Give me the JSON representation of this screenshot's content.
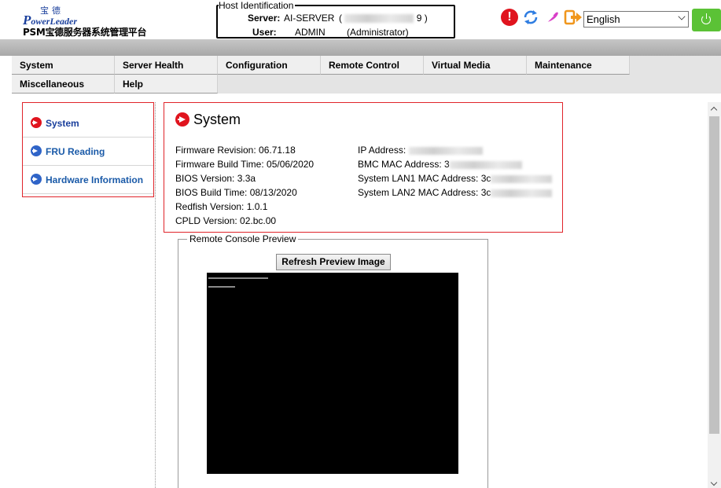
{
  "brand": {
    "logo_cn": "宝德",
    "logo_en_prefix": "P",
    "logo_en_rest": "owerLeader",
    "subtitle": "PSM宝德服务器系统管理平台"
  },
  "host": {
    "legend": "Host Identification",
    "server_label": "Server:",
    "server_value": "AI-SERVER",
    "server_paren_open": "(",
    "server_paren_tail": "9 )",
    "user_label": "User:",
    "user_value": "ADMIN",
    "user_role": "(Administrator)"
  },
  "toolbar": {
    "alert_glyph": "!",
    "language": "English"
  },
  "menu": {
    "row1": [
      "System",
      "Server Health",
      "Configuration",
      "Remote Control",
      "Virtual Media",
      "Maintenance"
    ],
    "row2": [
      "Miscellaneous",
      "Help"
    ]
  },
  "sidebar": {
    "items": [
      {
        "label": "System",
        "icon": "arrow-right-circle-red-icon"
      },
      {
        "label": "FRU Reading",
        "icon": "arrow-right-circle-blue-icon"
      },
      {
        "label": "Hardware Information",
        "icon": "arrow-right-circle-blue-icon"
      }
    ]
  },
  "system": {
    "title": "System",
    "left": [
      {
        "label": "Firmware Revision:",
        "value": "06.71.18"
      },
      {
        "label": "Firmware Build Time:",
        "value": "05/06/2020"
      },
      {
        "label": "BIOS Version:",
        "value": "3.3a"
      },
      {
        "label": "BIOS Build Time:",
        "value": "08/13/2020"
      },
      {
        "label": "Redfish Version:",
        "value": "1.0.1"
      },
      {
        "label": "CPLD Version:",
        "value": "02.bc.00"
      }
    ],
    "right": [
      {
        "label": "IP Address:",
        "value": ""
      },
      {
        "label": "BMC MAC Address:",
        "value": "3"
      },
      {
        "label": "System LAN1 MAC Address:",
        "value": "3c"
      },
      {
        "label": "System LAN2 MAC Address:",
        "value": "3c"
      }
    ]
  },
  "console": {
    "legend": "Remote Console Preview",
    "refresh_label": "Refresh Preview Image"
  },
  "colors": {
    "accent_red": "#e0242a",
    "link_blue": "#1a3f9c",
    "power_green": "#5bc236"
  }
}
